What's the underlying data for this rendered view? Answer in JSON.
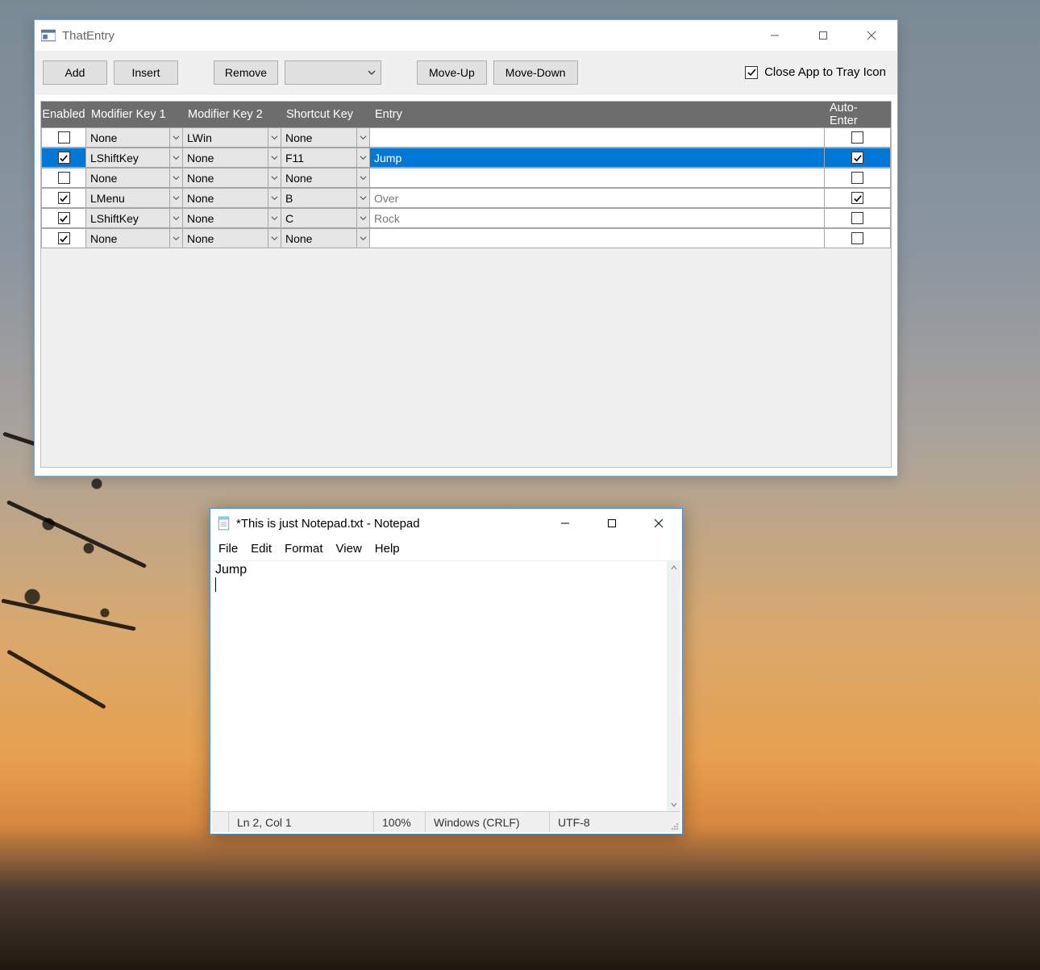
{
  "thatentry": {
    "title": "ThatEntry",
    "toolbar": {
      "add": "Add",
      "insert": "Insert",
      "remove": "Remove",
      "moveUp": "Move-Up",
      "moveDown": "Move-Down",
      "closeToTray": "Close App to Tray Icon",
      "closeToTrayChecked": true
    },
    "headers": {
      "enabled": "Enabled",
      "mod1": "Modifier Key 1",
      "mod2": "Modifier Key 2",
      "shortcut": "Shortcut Key",
      "entry": "Entry",
      "auto": "Auto-Enter"
    },
    "rows": [
      {
        "enabled": false,
        "mod1": "None",
        "mod2": "LWin",
        "shortcut": "None",
        "entry": "",
        "auto": false,
        "selected": false
      },
      {
        "enabled": true,
        "mod1": "LShiftKey",
        "mod2": "None",
        "shortcut": "F11",
        "entry": "Jump",
        "auto": true,
        "selected": true
      },
      {
        "enabled": false,
        "mod1": "None",
        "mod2": "None",
        "shortcut": "None",
        "entry": "",
        "auto": false,
        "selected": false
      },
      {
        "enabled": true,
        "mod1": "LMenu",
        "mod2": "None",
        "shortcut": "B",
        "entry": "Over",
        "auto": true,
        "selected": false
      },
      {
        "enabled": true,
        "mod1": "LShiftKey",
        "mod2": "None",
        "shortcut": "C",
        "entry": "Rock",
        "auto": false,
        "selected": false
      },
      {
        "enabled": true,
        "mod1": "None",
        "mod2": "None",
        "shortcut": "None",
        "entry": "",
        "auto": false,
        "selected": false
      }
    ]
  },
  "notepad": {
    "title": "*This is just Notepad.txt - Notepad",
    "menu": {
      "file": "File",
      "edit": "Edit",
      "format": "Format",
      "view": "View",
      "help": "Help"
    },
    "content": "Jump",
    "status": {
      "pos": "Ln 2, Col 1",
      "zoom": "100%",
      "eol": "Windows (CRLF)",
      "enc": "UTF-8"
    }
  }
}
